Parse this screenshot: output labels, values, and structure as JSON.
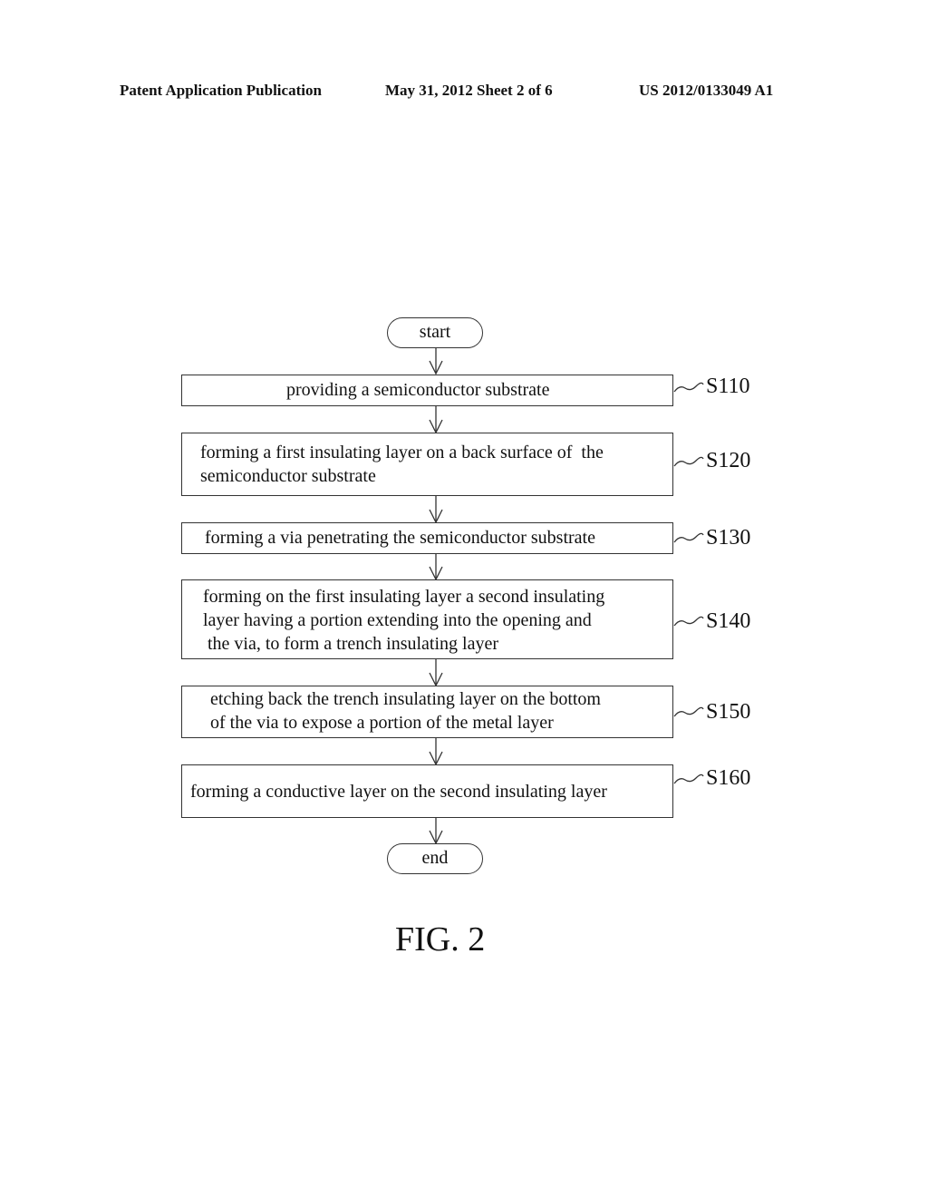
{
  "header": {
    "publication": "Patent Application Publication",
    "date_sheet": "May 31, 2012   Sheet 2 of 6",
    "number": "US 2012/0133049 A1"
  },
  "flowchart": {
    "start_label": "start",
    "end_label": "end",
    "steps": [
      {
        "id": "S110",
        "lines": [
          "providing a semiconductor substrate"
        ]
      },
      {
        "id": "S120",
        "lines": [
          "forming a first insulating layer on a back surface of  the",
          "semiconductor substrate"
        ]
      },
      {
        "id": "S130",
        "lines": [
          "forming a via penetrating the semiconductor substrate"
        ]
      },
      {
        "id": "S140",
        "lines": [
          "forming on the first insulating layer a second insulating",
          "layer having a portion extending into the opening and",
          " the via, to form a trench insulating layer"
        ]
      },
      {
        "id": "S150",
        "lines": [
          "etching back the trench insulating layer on the bottom",
          "of the via to expose a portion of the metal layer"
        ]
      },
      {
        "id": "S160",
        "lines": [
          "forming a conductive layer on the second insulating layer"
        ]
      }
    ]
  },
  "figure_caption": "FIG. 2"
}
